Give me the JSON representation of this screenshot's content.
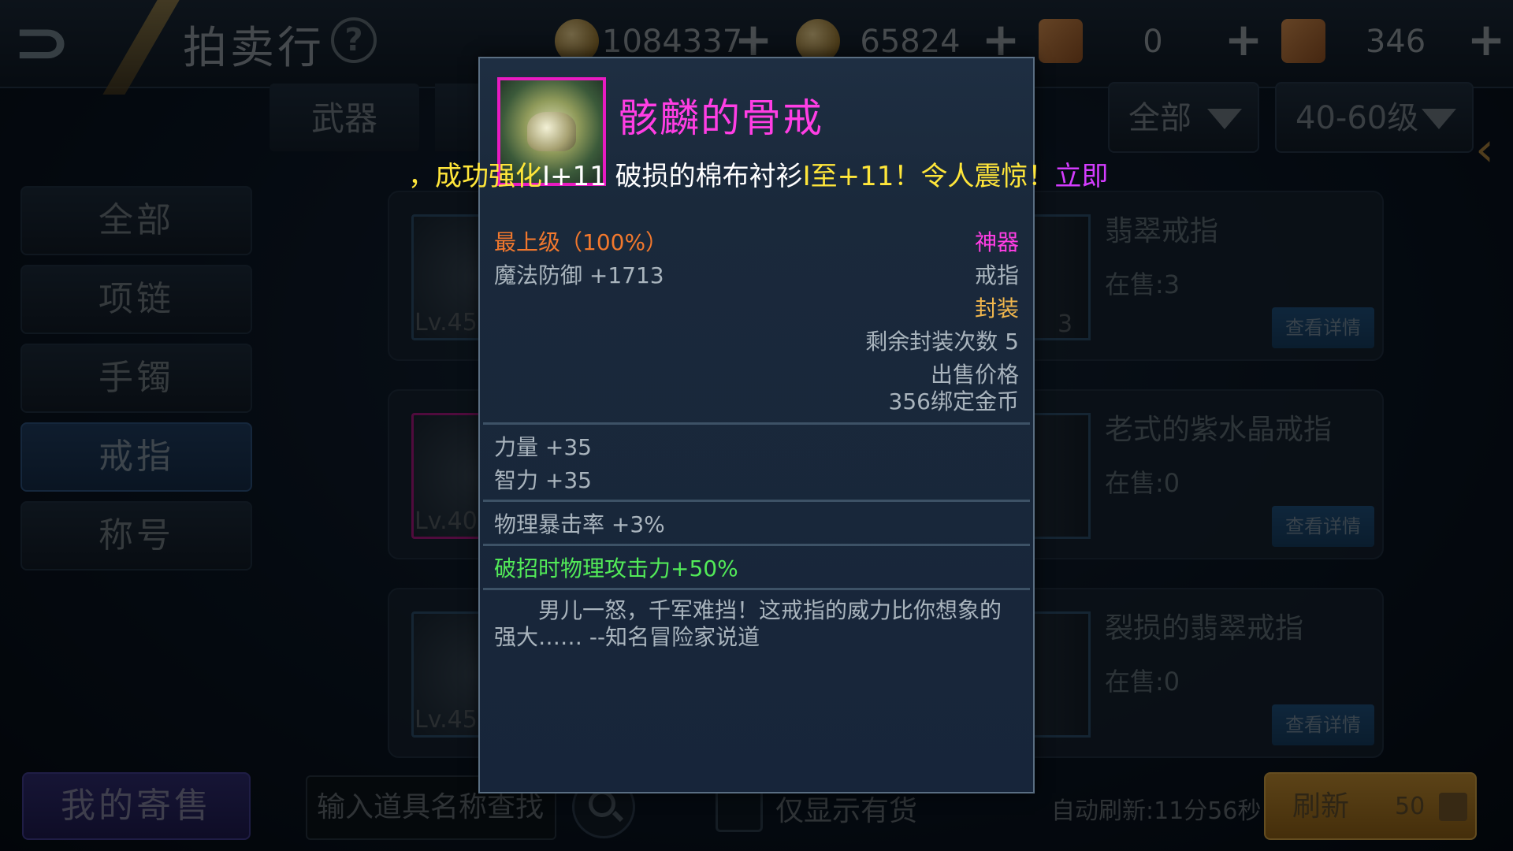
{
  "header": {
    "title": "拍卖行",
    "help_glyph": "?",
    "currencies": [
      {
        "icon": "gold-coin-icon",
        "value": "1084337"
      },
      {
        "icon": "bound-coin-icon",
        "value": "65824"
      },
      {
        "icon": "scroll-icon",
        "value": "0"
      },
      {
        "icon": "locked-scroll-icon",
        "value": "346"
      }
    ],
    "plus_glyph": "+"
  },
  "filters": {
    "category_tab": "武器",
    "quality_dropdown": "全部",
    "level_dropdown": "40-60级"
  },
  "sidebar": {
    "items": [
      {
        "label": "全部",
        "active": false
      },
      {
        "label": "项链",
        "active": false
      },
      {
        "label": "手镯",
        "active": false
      },
      {
        "label": "戒指",
        "active": true
      },
      {
        "label": "称号",
        "active": false
      }
    ],
    "my_sale": "我的寄售"
  },
  "listings": [
    {
      "level": "Lv.45",
      "count": "3",
      "name": "翡翠戒指",
      "stock": "在售:3",
      "button": "查看详情"
    },
    {
      "level": "Lv.40",
      "count": "",
      "name": "老式的紫水晶戒指",
      "stock": "在售:0",
      "button": "查看详情"
    },
    {
      "level": "Lv.45",
      "count": "",
      "name": "裂损的翡翠戒指",
      "stock": "在售:0",
      "button": "查看详情"
    }
  ],
  "bottom": {
    "search_placeholder": "输入道具名称查找",
    "only_in_stock": "仅显示有货",
    "auto_refresh": "自动刷新:11分56秒",
    "refresh_label": "刷新",
    "refresh_cost": "50"
  },
  "broadcast": {
    "segments": [
      {
        "text": "，成功强化",
        "color": "#ffe63a"
      },
      {
        "text": "I+11 破损的棉布衬衫",
        "color": "#ffffff"
      },
      {
        "text": "I至+11！令人震惊！",
        "color": "#ffe63a"
      },
      {
        "text": "立即",
        "color": "#d43cff"
      }
    ]
  },
  "tooltip": {
    "item_name": "骸麟的骨戒",
    "grade": "最上级（100%）",
    "quality": "神器",
    "magic_defense": "魔法防御 +1713",
    "item_type": "戒指",
    "sealed": "封装",
    "seal_remaining": "剩余封装次数 5",
    "price_label": "出售价格",
    "price_value": "356绑定金币",
    "strength": "力量 +35",
    "intelligence": "智力 +35",
    "phys_crit": "物理暴击率 +3%",
    "special": "破招时物理攻击力+50%",
    "description": "男儿一怒，千军难挡！这戒指的威力比你想象的强大…… --知名冒险家说道"
  },
  "colors": {
    "legendary": "#ff3ee4",
    "grade_orange": "#f2782d",
    "sealed_gold": "#f0b64d",
    "special_green": "#52ea58"
  }
}
